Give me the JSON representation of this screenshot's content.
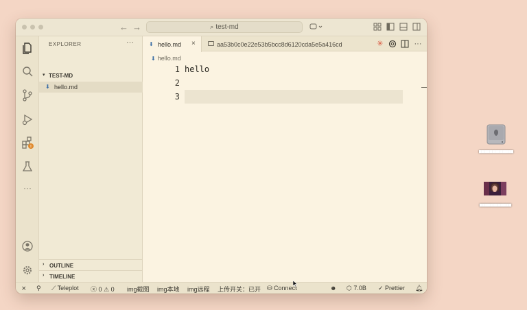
{
  "titlebar": {
    "search": "test-md"
  },
  "sidebar": {
    "title": "EXPLORER",
    "more": "···",
    "folder": "TEST-MD",
    "files": [
      {
        "label": "hello.md"
      }
    ],
    "outline": "OUTLINE",
    "timeline": "TIMELINE"
  },
  "tabs": {
    "active": {
      "label": "hello.md",
      "close": "×"
    },
    "second": {
      "label": "aa53b0c0e22e53b5bcc8d6120cda5e5a416cd"
    }
  },
  "breadcrumb": {
    "file": "hello.md"
  },
  "editor": {
    "lines": [
      {
        "number": "1",
        "text": "hello"
      },
      {
        "number": "2",
        "text": ""
      },
      {
        "number": "3",
        "text": ""
      }
    ]
  },
  "statusbar": {
    "teleplot": "Teleplot",
    "errors": "0",
    "warnings": "0",
    "img_capture": "img截图",
    "img_local": "img本地",
    "img_remote": "img远程",
    "upload_switch": "上传开关：已开",
    "connect": "Connect",
    "size": "7.0B",
    "prettier": "Prettier"
  },
  "colors": {
    "accent_blue": "#3d6fa6",
    "warning_badge": "#e08a2e"
  },
  "icons": {
    "activity": [
      "files-icon",
      "search-icon",
      "source-control-icon",
      "run-debug-icon",
      "extensions-icon",
      "testing-icon",
      "more-icon",
      "account-icon",
      "settings-gear-icon"
    ]
  }
}
